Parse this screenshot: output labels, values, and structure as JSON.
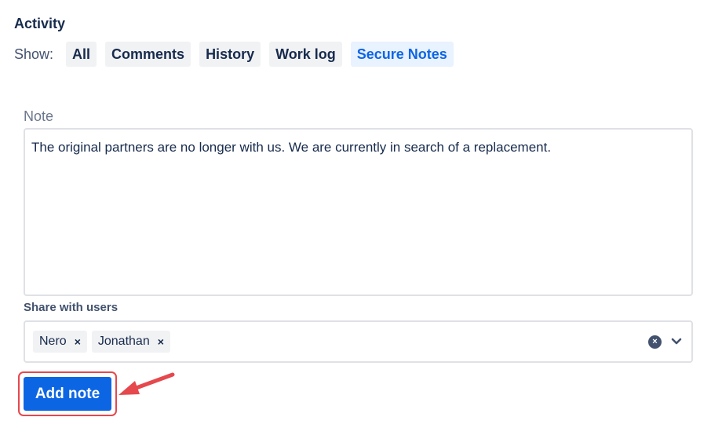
{
  "activity": {
    "title": "Activity",
    "show_label": "Show:",
    "filters": [
      {
        "label": "All",
        "selected": false
      },
      {
        "label": "Comments",
        "selected": false
      },
      {
        "label": "History",
        "selected": false
      },
      {
        "label": "Work log",
        "selected": false
      },
      {
        "label": "Secure Notes",
        "selected": true
      }
    ]
  },
  "note": {
    "label": "Note",
    "value": "The original partners are no longer with us. We are currently in search of a replacement."
  },
  "share": {
    "label": "Share with users",
    "users": [
      "Nero",
      "Jonathan"
    ],
    "remove_glyph": "×",
    "clear_glyph": "×"
  },
  "actions": {
    "add_note_label": "Add note"
  },
  "colors": {
    "primary": "#0c66e4",
    "selected_bg": "#e9f2ff",
    "annotation": "#e5484d"
  },
  "icons": {
    "remove_tag": "cross-icon",
    "clear": "clear-circle-icon",
    "dropdown": "chevron-down-icon",
    "annotation": "arrow-icon"
  }
}
